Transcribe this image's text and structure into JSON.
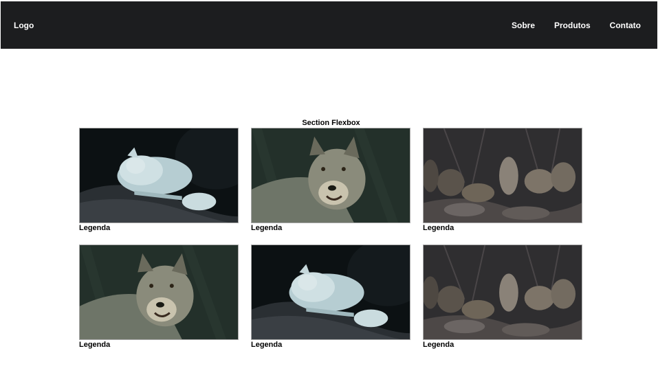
{
  "navbar": {
    "logo": "Logo",
    "links": [
      "Sobre",
      "Produtos",
      "Contato"
    ]
  },
  "section": {
    "title": "Section Flexbox"
  },
  "gallery": {
    "items": [
      {
        "image": "wolf-lying",
        "caption": "Legenda"
      },
      {
        "image": "wolf-portrait",
        "caption": "Legenda"
      },
      {
        "image": "wolf-pack",
        "caption": "Legenda"
      },
      {
        "image": "wolf-portrait",
        "caption": "Legenda"
      },
      {
        "image": "wolf-lying",
        "caption": "Legenda"
      },
      {
        "image": "wolf-pack",
        "caption": "Legenda"
      }
    ]
  },
  "colors": {
    "navbar_bg": "#1c1d1f",
    "nav_text": "#ffffff",
    "page_bg": "#ffffff"
  }
}
